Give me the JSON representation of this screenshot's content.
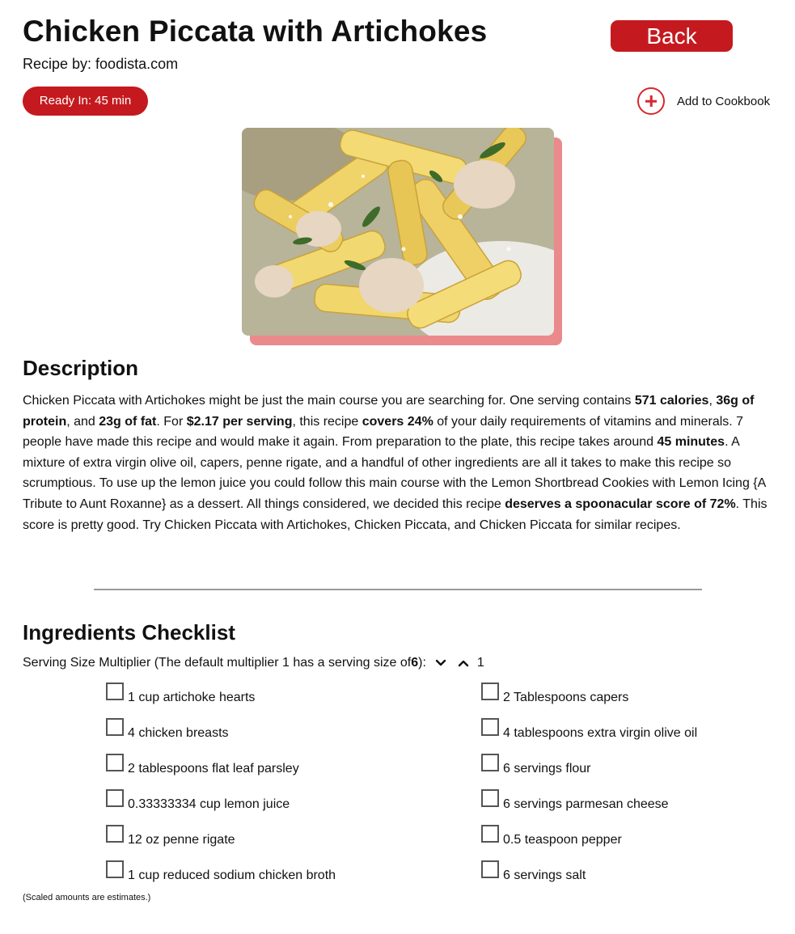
{
  "header": {
    "title": "Chicken Piccata with Artichokes",
    "byline_prefix": "Recipe by: ",
    "byline_source": "foodista.com",
    "back_label": "Back",
    "ready_prefix": "Ready In: ",
    "ready_value": "45 min",
    "add_cookbook_label": "Add to Cookbook"
  },
  "image": {
    "alt": "Chicken Piccata with Artichokes"
  },
  "description": {
    "heading": "Description",
    "parts": {
      "p1": "Chicken Piccata with Artichokes might be just the main course you are searching for. One serving contains ",
      "b1": "571 calories",
      "p2": ", ",
      "b2": "36g of protein",
      "p3": ", and ",
      "b3": "23g of fat",
      "p4": ". For ",
      "b4": "$2.17 per serving",
      "p5": ", this recipe ",
      "b5": "covers 24%",
      "p6": " of your daily requirements of vitamins and minerals. 7 people have made this recipe and would make it again. From preparation to the plate, this recipe takes around ",
      "b6": "45 minutes",
      "p7": ". A mixture of extra virgin olive oil, capers, penne rigate, and a handful of other ingredients are all it takes to make this recipe so scrumptious. To use up the lemon juice you could follow this main course with the Lemon Shortbread Cookies with Lemon Icing {A Tribute to Aunt Roxanne} as a dessert. All things considered, we decided this recipe ",
      "b7": "deserves a spoonacular score of 72%",
      "p8": ". This score is pretty good. Try Chicken Piccata with Artichokes, Chicken Piccata, and Chicken Piccata for similar recipes."
    }
  },
  "ingredients": {
    "heading": "Ingredients Checklist",
    "multiplier_prefix": "Serving Size Multiplier (The default multiplier 1 has a serving size of ",
    "multiplier_serving": "6",
    "multiplier_suffix": "):",
    "multiplier_value": "1",
    "left": [
      "1 cup artichoke hearts",
      "4 chicken breasts",
      "2 tablespoons flat leaf parsley",
      "0.33333334 cup lemon juice",
      "12 oz penne rigate",
      "1 cup reduced sodium chicken broth"
    ],
    "right": [
      "2 Tablespoons capers",
      "4 tablespoons extra virgin olive oil",
      "6 servings flour",
      "6 servings parmesan cheese",
      "0.5 teaspoon pepper",
      "6 servings salt"
    ],
    "footnote": "(Scaled amounts are estimates.)"
  },
  "colors": {
    "accent": "#c41a1f",
    "image_shadow": "#ea8a8c",
    "divider": "#9a9a9a"
  }
}
